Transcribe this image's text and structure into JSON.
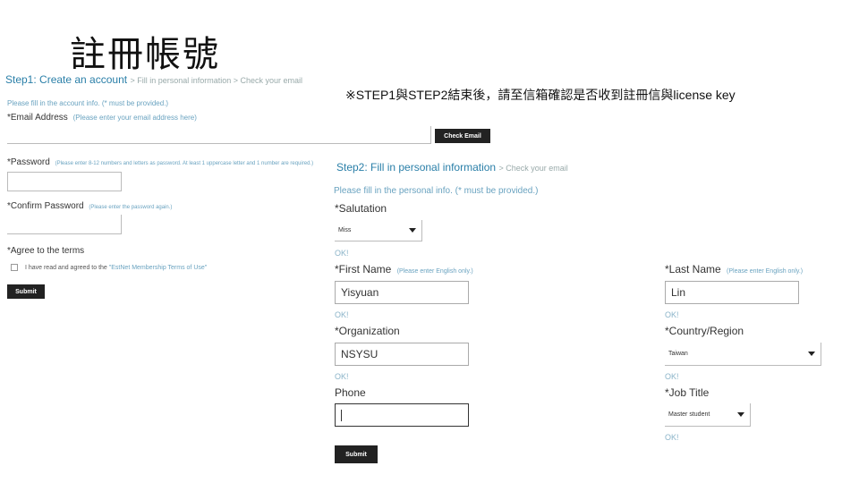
{
  "slide": {
    "title": "註冊帳號",
    "note": "※STEP1與STEP2結束後，請至信箱確認是否收到註冊信與license key"
  },
  "step1": {
    "heading": "Step1: Create an account",
    "heading_rest": "> Fill in personal information > Check your email",
    "intro": "Please fill in the account info. (* must be provided.)",
    "email_label": "*Email Address",
    "email_hint": "(Please enter your email address here)",
    "check_email_button": "Check Email",
    "password_label": "*Password",
    "password_hint": "(Please enter 8-12 numbers and letters as password. At least 1 uppercase letter and 1 number are required.)",
    "confirm_label": "*Confirm Password",
    "confirm_hint": "(Please enter the password again.)",
    "terms_label": "*Agree to the terms",
    "agree_text": "I have read and agreed to the",
    "agree_link": "\"EstNet Membership Terms of Use\"",
    "submit_button": "Submit"
  },
  "step2": {
    "heading": "Step2: Fill in personal information",
    "heading_rest": "> Check your email",
    "intro": "Please fill in the personal info. (* must be provided.)",
    "salutation_label": "*Salutation",
    "salutation_value": "Miss",
    "ok": "OK!",
    "first_name_label": "*First Name",
    "first_name_hint": "(Please enter English only.)",
    "first_name_value": "Yisyuan",
    "last_name_label": "*Last Name",
    "last_name_hint": "(Please enter English only.)",
    "last_name_value": "Lin",
    "organization_label": "*Organization",
    "organization_value": "NSYSU",
    "country_label": "*Country/Region",
    "country_value": "Taiwan",
    "phone_label": "Phone",
    "phone_value": "",
    "job_title_label": "*Job Title",
    "job_title_value": "Master student",
    "submit_button": "Submit"
  }
}
